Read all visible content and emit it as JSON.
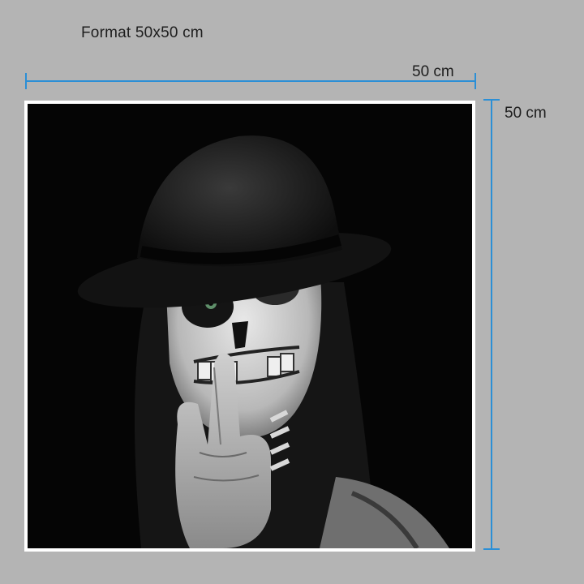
{
  "header": {
    "format_label": "Format 50x50 cm"
  },
  "dimensions": {
    "width_label": "50 cm",
    "height_label": "50 cm"
  },
  "colors": {
    "background": "#b4b4b4",
    "measure_line": "#2b8fd6",
    "frame": "#ffffff",
    "photo_background": "#050505"
  },
  "artwork": {
    "subject": "black-and-white portrait, skull face paint, black hat, finger to lips, green eyes"
  }
}
